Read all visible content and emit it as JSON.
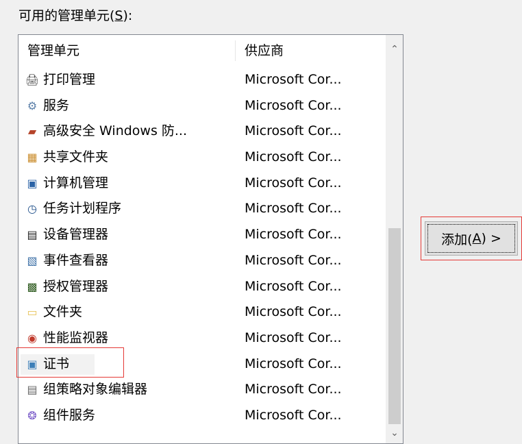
{
  "group_label": {
    "prefix": "可用的管理单元(",
    "access_key": "S",
    "suffix": "):"
  },
  "columns": {
    "name": "管理单元",
    "vendor": "供应商"
  },
  "snapins": [
    {
      "icon": "printer-icon",
      "glyph": "🖨",
      "color": "#444444",
      "name": "打印管理",
      "vendor": "Microsoft Cor..."
    },
    {
      "icon": "gears-icon",
      "glyph": "⚙",
      "color": "#5b7fa8",
      "name": "服务",
      "vendor": "Microsoft Cor..."
    },
    {
      "icon": "firewall-icon",
      "glyph": "▰",
      "color": "#b5452b",
      "name": "高级安全 Windows 防...",
      "vendor": "Microsoft Cor..."
    },
    {
      "icon": "shared-folder-icon",
      "glyph": "▦",
      "color": "#c98b2a",
      "name": "共享文件夹",
      "vendor": "Microsoft Cor..."
    },
    {
      "icon": "computer-management-icon",
      "glyph": "▣",
      "color": "#2b63a6",
      "name": "计算机管理",
      "vendor": "Microsoft Cor..."
    },
    {
      "icon": "clock-icon",
      "glyph": "◷",
      "color": "#1f4f8a",
      "name": "任务计划程序",
      "vendor": "Microsoft Cor..."
    },
    {
      "icon": "device-manager-icon",
      "glyph": "▤",
      "color": "#222222",
      "name": "设备管理器",
      "vendor": "Microsoft Cor..."
    },
    {
      "icon": "event-viewer-icon",
      "glyph": "▧",
      "color": "#3a6ea5",
      "name": "事件查看器",
      "vendor": "Microsoft Cor..."
    },
    {
      "icon": "authorization-manager-icon",
      "glyph": "▩",
      "color": "#2d5a1e",
      "name": "授权管理器",
      "vendor": "Microsoft Cor..."
    },
    {
      "icon": "folder-icon",
      "glyph": "▭",
      "color": "#e8c45a",
      "name": "文件夹",
      "vendor": "Microsoft Cor..."
    },
    {
      "icon": "performance-monitor-icon",
      "glyph": "◉",
      "color": "#c0392b",
      "name": "性能监视器",
      "vendor": "Microsoft Cor..."
    },
    {
      "icon": "certificate-icon",
      "glyph": "▣",
      "color": "#3d7fb8",
      "name": "证书",
      "vendor": "Microsoft Cor..."
    },
    {
      "icon": "group-policy-editor-icon",
      "glyph": "▤",
      "color": "#666666",
      "name": "组策略对象编辑器",
      "vendor": "Microsoft Cor..."
    },
    {
      "icon": "component-services-icon",
      "glyph": "❂",
      "color": "#7a5cc9",
      "name": "组件服务",
      "vendor": "Microsoft Cor..."
    }
  ],
  "add_button": {
    "prefix": "添加(",
    "access_key": "A",
    "suffix": ") >"
  },
  "scroll": {
    "up": "▲",
    "down": "▼"
  },
  "colors": {
    "highlight": "#e53935",
    "scroll_thumb": "#cdcdcd"
  }
}
